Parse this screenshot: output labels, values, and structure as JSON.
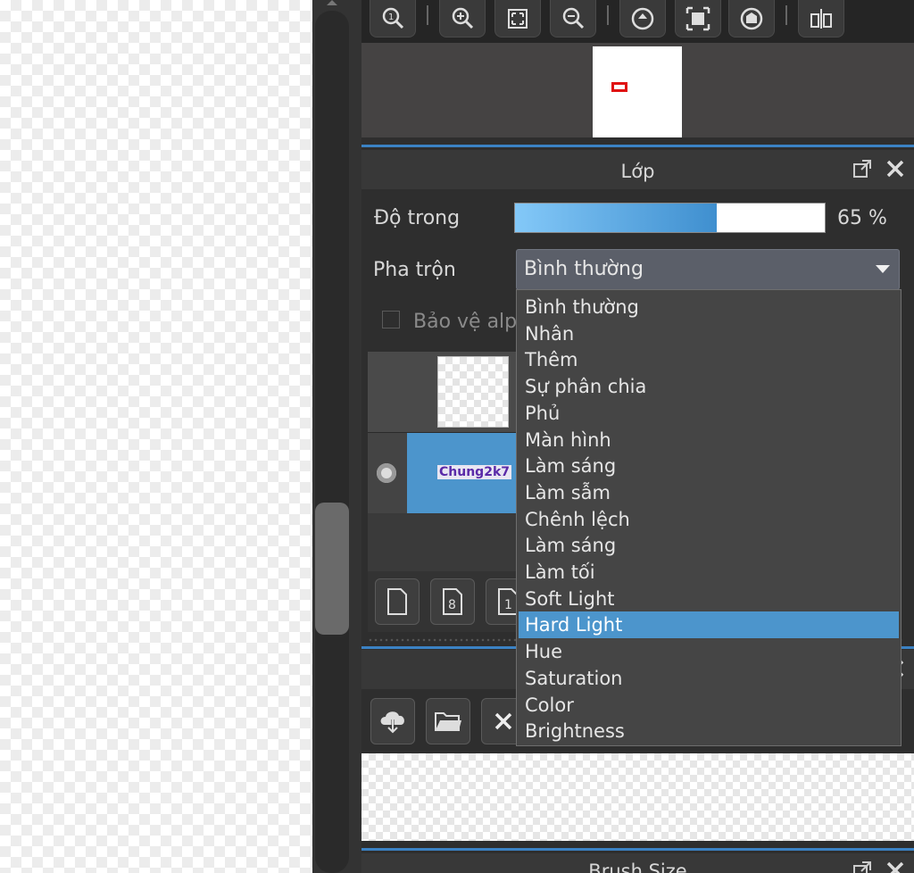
{
  "navigator": {
    "toolbar_icons": [
      "zoom-reset-icon",
      "zoom-in-icon",
      "fit-screen-icon",
      "zoom-out-icon",
      "rotate-icon",
      "fullscreen-icon",
      "rotate-reset-icon",
      "flip-icon"
    ]
  },
  "layer_panel": {
    "title": "Lớp",
    "opacity_label": "Độ trong",
    "opacity_value": 65,
    "opacity_text": "65 %",
    "blend_label": "Pha trộn",
    "blend_value": "Bình thường",
    "protect_alpha_label": "Bảo vệ alp",
    "layers": [
      {
        "name": ""
      },
      {
        "name": "Chung2k7"
      }
    ]
  },
  "blend_dropdown": {
    "options": [
      "Bình thường",
      "Nhân",
      "Thêm",
      "Sự phân chia",
      "Phủ",
      "Màn hình",
      "Làm sáng",
      "Làm sẫm",
      "Chênh lệch",
      "Làm sáng",
      "Làm tối",
      "Soft Light",
      "Hard Light",
      "Hue",
      "Saturation",
      "Color",
      "Brightness"
    ],
    "highlighted_index": 12
  },
  "brush_size_panel": {
    "title": "Brush Size"
  },
  "colors": {
    "accent": "#4c95cc",
    "panel_bg": "#2e2e2e",
    "divider": "#3b82c4"
  }
}
